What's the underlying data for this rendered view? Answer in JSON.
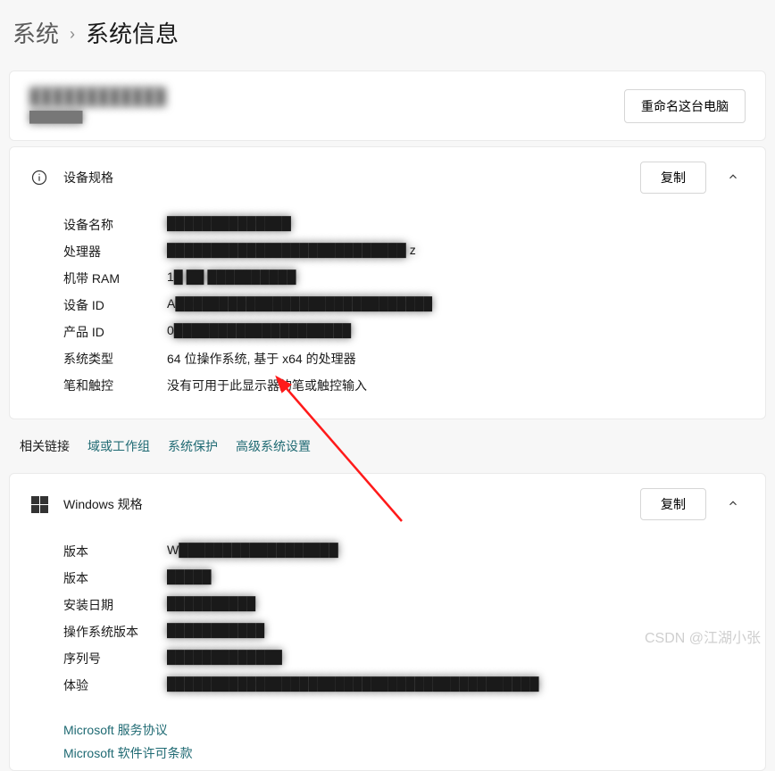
{
  "breadcrumb": {
    "parent": "系统",
    "current": "系统信息"
  },
  "rename": {
    "pc_name_masked": "████████████",
    "pc_sub_masked": "███████",
    "button": "重命名这台电脑"
  },
  "device_specs": {
    "title": "设备规格",
    "copy": "复制",
    "rows": [
      {
        "label": "设备名称",
        "value_masked": "██████████████"
      },
      {
        "label": "处理器",
        "value_masked": "███████████████████████████ z"
      },
      {
        "label": "机带 RAM",
        "value_masked": "1█ ██ ██████████"
      },
      {
        "label": "设备 ID",
        "value_masked": "A█████████████████████████████"
      },
      {
        "label": "产品 ID",
        "value_masked": "0████████████████████"
      },
      {
        "label": "系统类型",
        "value": "64 位操作系统, 基于 x64 的处理器"
      },
      {
        "label": "笔和触控",
        "value": "没有可用于此显示器的笔或触控输入"
      }
    ]
  },
  "related": {
    "label": "相关链接",
    "links": [
      "域或工作组",
      "系统保护",
      "高级系统设置"
    ]
  },
  "windows_specs": {
    "title": "Windows 规格",
    "copy": "复制",
    "rows": [
      {
        "label": "版本",
        "value_masked": "W██████████████████"
      },
      {
        "label": "版本",
        "value_masked": "█████"
      },
      {
        "label": "安装日期",
        "value_masked": "██████████"
      },
      {
        "label": "操作系统版本",
        "value_masked": "███████████"
      },
      {
        "label": "序列号",
        "value_masked": "█████████████"
      },
      {
        "label": "体验",
        "value_masked": "██████████████████████████████████████████"
      }
    ],
    "links": [
      "Microsoft 服务协议",
      "Microsoft 软件许可条款"
    ]
  },
  "watermark": "CSDN @江湖小张"
}
